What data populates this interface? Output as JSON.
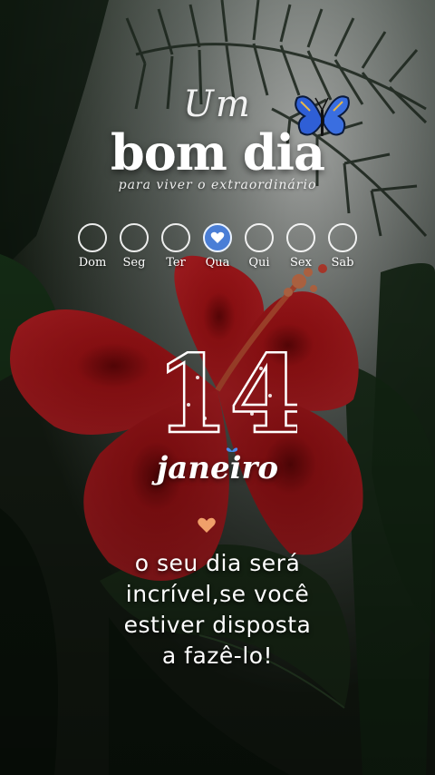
{
  "header": {
    "script_title": "Um",
    "main_title": "bom dia",
    "subtitle": "para viver o extraordinário"
  },
  "week": {
    "days": [
      "Dom",
      "Seg",
      "Ter",
      "Qua",
      "Qui",
      "Sex",
      "Sab"
    ],
    "selected_day": "Qua"
  },
  "date": {
    "day_number": "14",
    "month": "janeiro"
  },
  "message": {
    "lines": [
      "o seu dia será",
      "incrível,se você",
      "estiver disposta",
      "a fazê-lo!"
    ]
  },
  "colors": {
    "flower_red": "#c8181b",
    "selected_day_fill": "#4a7ed6",
    "heart": "#f0a06a",
    "butterfly_blue": "#2f5fd6"
  },
  "icons": {
    "top_butterfly": "butterfly-icon",
    "selected_marker": "heart-icon"
  }
}
